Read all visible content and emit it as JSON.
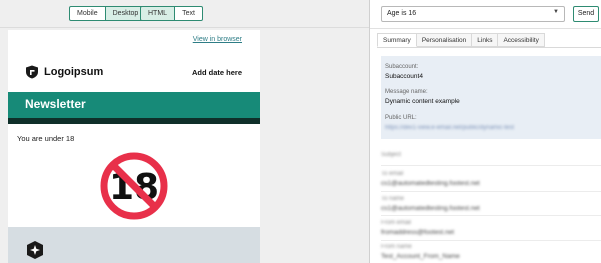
{
  "toolbar": {
    "view_modes": [
      "Mobile",
      "Desktop"
    ],
    "active_view": "Desktop",
    "formats": [
      "HTML",
      "Text"
    ],
    "active_format": "HTML"
  },
  "email": {
    "view_in_browser": "View in browser",
    "logo_text": "Logoipsum",
    "add_date": "Add date here",
    "banner_title": "Newsletter",
    "age_text": "You are under 18",
    "age_sign_number": "18",
    "colors": {
      "banner": "#178a78",
      "banner_strip": "#0f2f2a",
      "sign_red": "#e8304a"
    }
  },
  "right_panel": {
    "select_value": "Age is 16",
    "send_label": "Send",
    "tabs": [
      "Summary",
      "Personalisation",
      "Links",
      "Accessibility"
    ],
    "active_tab": "Summary",
    "summary": {
      "subaccount_label": "Subaccount:",
      "subaccount_value": "Subaccount4",
      "message_name_label": "Message name:",
      "message_name_value": "Dynamic content example",
      "public_url_label": "Public URL:",
      "public_url_value": "https://dev1-view.e-email.net/public/dynamic-test"
    },
    "fields": [
      {
        "label": "Subject",
        "value": ""
      },
      {
        "label": "To email",
        "value": "cs1@automatedtesting.footest.net"
      },
      {
        "label": "To name",
        "value": "cs1@automatedtesting.footest.net"
      },
      {
        "label": "From email",
        "value": "fromaddress@footest.net"
      },
      {
        "label": "From name",
        "value": "Test_Account_From_Name"
      }
    ]
  }
}
